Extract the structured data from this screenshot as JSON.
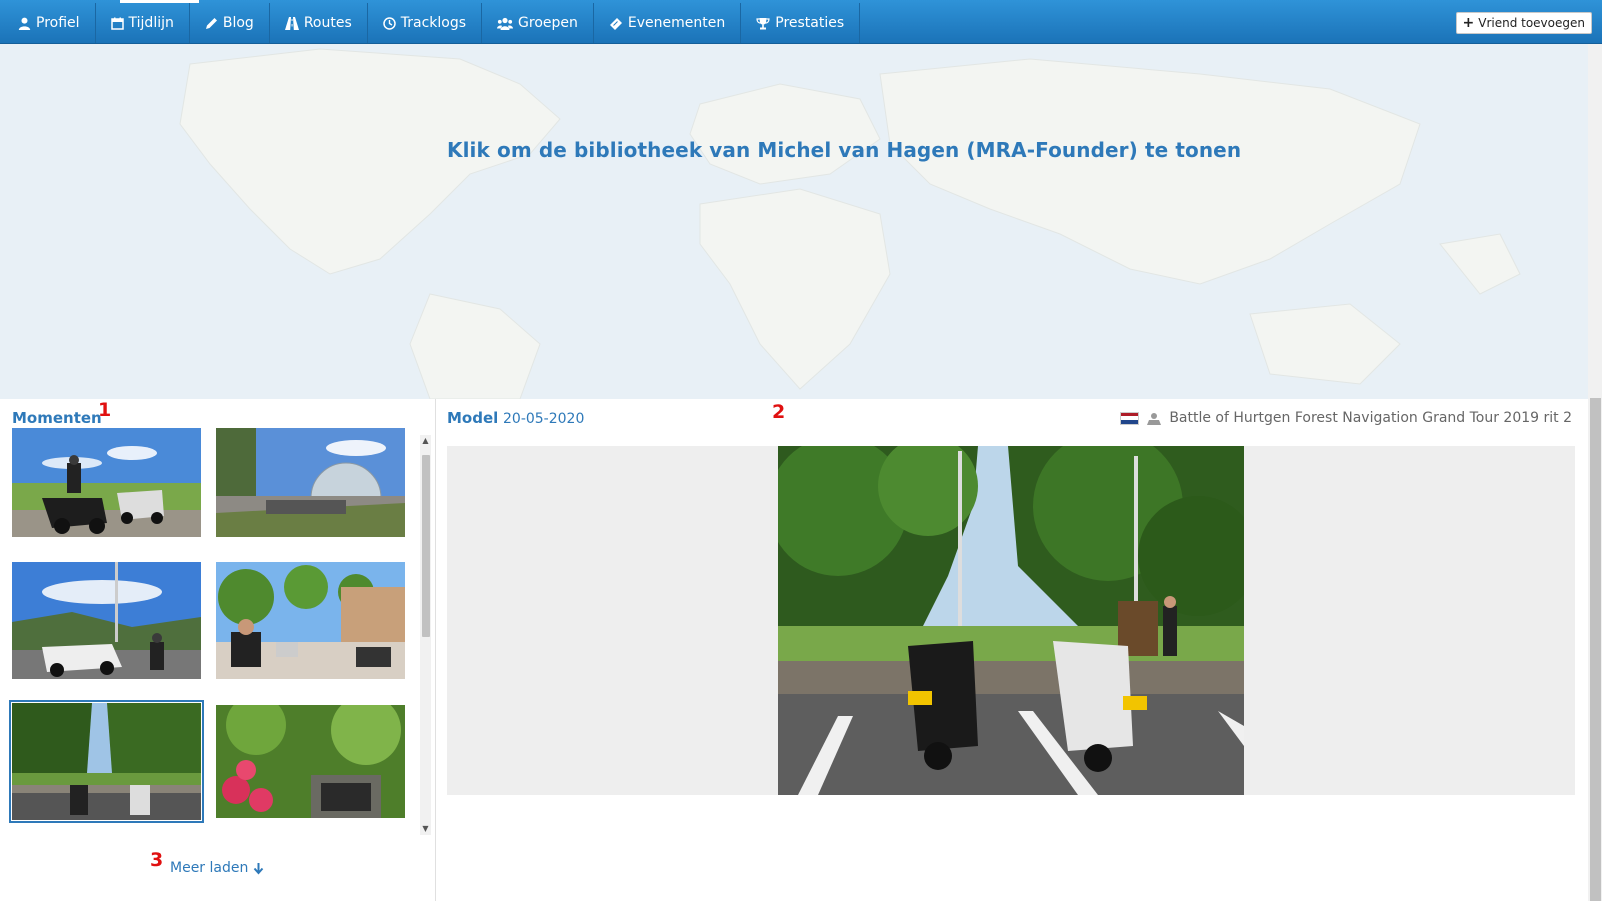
{
  "nav": {
    "items": [
      {
        "label": "Profiel",
        "icon": "user-icon"
      },
      {
        "label": "Tijdlijn",
        "icon": "calendar-icon"
      },
      {
        "label": "Blog",
        "icon": "pencil-icon"
      },
      {
        "label": "Routes",
        "icon": "road-icon"
      },
      {
        "label": "Tracklogs",
        "icon": "clock-icon"
      },
      {
        "label": "Groepen",
        "icon": "group-icon"
      },
      {
        "label": "Evenementen",
        "icon": "ticket-icon"
      },
      {
        "label": "Prestaties",
        "icon": "trophy-icon"
      }
    ],
    "active_index": 1,
    "friend_button": "Vriend toevoegen"
  },
  "banner": {
    "text": "Klik om de bibliotheek van Michel van Hagen (MRA-Founder) te tonen"
  },
  "moments": {
    "title": "Momenten",
    "marker": "1",
    "selected_index": 4,
    "load_more_marker": "3",
    "load_more_label": "Meer laden"
  },
  "model": {
    "title": "Model",
    "date": "20-05-2020",
    "marker": "2",
    "tour_title": "Battle of Hurtgen Forest Navigation Grand Tour 2019 rit 2"
  },
  "colors": {
    "accent": "#2e79b9",
    "nav_top": "#2f93d8",
    "nav_bottom": "#1b73b8",
    "marker_red": "#e01010"
  }
}
